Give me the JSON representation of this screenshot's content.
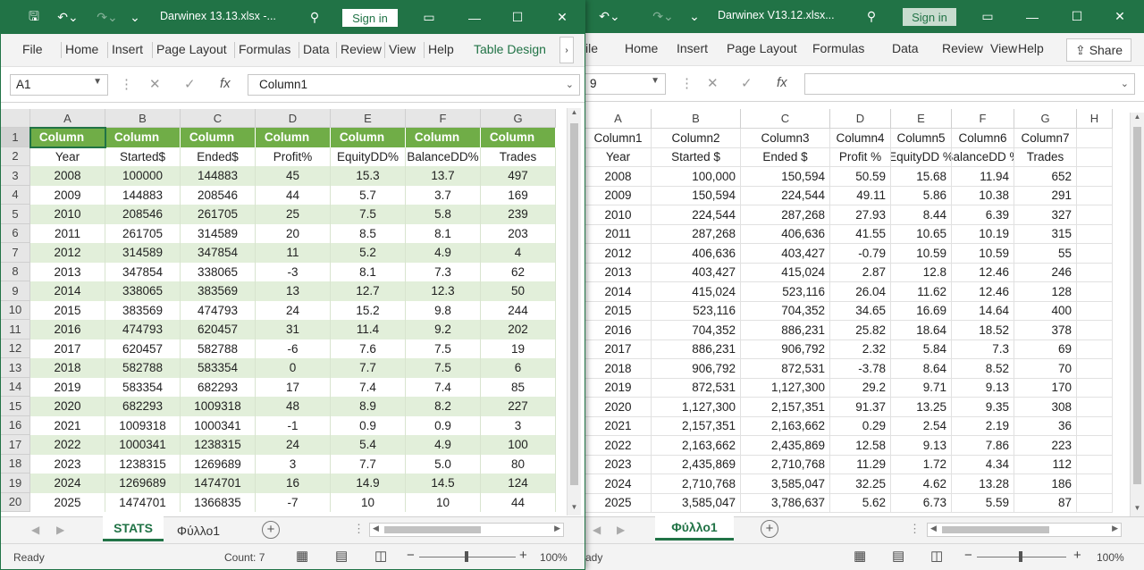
{
  "colors": {
    "accent": "#217346",
    "band": "#e2efda",
    "tableHeader": "#70ad47"
  },
  "left": {
    "title": "Darwinex 13.13.xlsx  -...",
    "sign_in": "Sign in",
    "ribbon": [
      "File",
      "Home",
      "Insert",
      "Page Layout",
      "Formulas",
      "Data",
      "Review",
      "View",
      "Help",
      "Table Design"
    ],
    "name_box": "A1",
    "formula": "Column1",
    "cols": [
      "A",
      "B",
      "C",
      "D",
      "E",
      "F",
      "G"
    ],
    "table_header": "Column",
    "rows": [
      [
        "Year",
        "Started$",
        "Ended$",
        "Profit%",
        "EquityDD%",
        "BalanceDD%",
        "Trades"
      ],
      [
        "2008",
        "100000",
        "144883",
        "45",
        "15.3",
        "13.7",
        "497"
      ],
      [
        "2009",
        "144883",
        "208546",
        "44",
        "5.7",
        "3.7",
        "169"
      ],
      [
        "2010",
        "208546",
        "261705",
        "25",
        "7.5",
        "5.8",
        "239"
      ],
      [
        "2011",
        "261705",
        "314589",
        "20",
        "8.5",
        "8.1",
        "203"
      ],
      [
        "2012",
        "314589",
        "347854",
        "11",
        "5.2",
        "4.9",
        "4"
      ],
      [
        "2013",
        "347854",
        "338065",
        "-3",
        "8.1",
        "7.3",
        "62"
      ],
      [
        "2014",
        "338065",
        "383569",
        "13",
        "12.7",
        "12.3",
        "50"
      ],
      [
        "2015",
        "383569",
        "474793",
        "24",
        "15.2",
        "9.8",
        "244"
      ],
      [
        "2016",
        "474793",
        "620457",
        "31",
        "11.4",
        "9.2",
        "202"
      ],
      [
        "2017",
        "620457",
        "582788",
        "-6",
        "7.6",
        "7.5",
        "19"
      ],
      [
        "2018",
        "582788",
        "583354",
        "0",
        "7.7",
        "7.5",
        "6"
      ],
      [
        "2019",
        "583354",
        "682293",
        "17",
        "7.4",
        "7.4",
        "85"
      ],
      [
        "2020",
        "682293",
        "1009318",
        "48",
        "8.9",
        "8.2",
        "227"
      ],
      [
        "2021",
        "1009318",
        "1000341",
        "-1",
        "0.9",
        "0.9",
        "3"
      ],
      [
        "2022",
        "1000341",
        "1238315",
        "24",
        "5.4",
        "4.9",
        "100"
      ],
      [
        "2023",
        "1238315",
        "1269689",
        "3",
        "7.7",
        "5.0",
        "80"
      ],
      [
        "2024",
        "1269689",
        "1474701",
        "16",
        "14.9",
        "14.5",
        "124"
      ],
      [
        "2025",
        "1474701",
        "1366835",
        "-7",
        "10",
        "10",
        "44"
      ]
    ],
    "sheet_tabs": [
      "STATS",
      "Φύλλο1"
    ],
    "status": "Ready",
    "count": "Count: 7",
    "zoom": "100%"
  },
  "right": {
    "title": "Darwinex V13.12.xlsx...",
    "sign_in": "Sign in",
    "share": "Share",
    "ribbon": [
      "ile",
      "Home",
      "Insert",
      "Page Layout",
      "Formulas",
      "Data",
      "Review",
      "View",
      "Help"
    ],
    "name_box": "9",
    "cols": [
      "A",
      "B",
      "C",
      "D",
      "E",
      "F",
      "G",
      "H"
    ],
    "rows": [
      [
        "Column1",
        "Column2",
        "Column3",
        "Column4",
        "Column5",
        "Column6",
        "Column7"
      ],
      [
        "Year",
        "Started $",
        "Ended $",
        "Profit %",
        "EquityDD %",
        "BalanceDD %",
        "Trades"
      ],
      [
        "2008",
        "100,000",
        "150,594",
        "50.59",
        "15.68",
        "11.94",
        "652"
      ],
      [
        "2009",
        "150,594",
        "224,544",
        "49.11",
        "5.86",
        "10.38",
        "291"
      ],
      [
        "2010",
        "224,544",
        "287,268",
        "27.93",
        "8.44",
        "6.39",
        "327"
      ],
      [
        "2011",
        "287,268",
        "406,636",
        "41.55",
        "10.65",
        "10.19",
        "315"
      ],
      [
        "2012",
        "406,636",
        "403,427",
        "-0.79",
        "10.59",
        "10.59",
        "55"
      ],
      [
        "2013",
        "403,427",
        "415,024",
        "2.87",
        "12.8",
        "12.46",
        "246"
      ],
      [
        "2014",
        "415,024",
        "523,116",
        "26.04",
        "11.62",
        "12.46",
        "128"
      ],
      [
        "2015",
        "523,116",
        "704,352",
        "34.65",
        "16.69",
        "14.64",
        "400"
      ],
      [
        "2016",
        "704,352",
        "886,231",
        "25.82",
        "18.64",
        "18.52",
        "378"
      ],
      [
        "2017",
        "886,231",
        "906,792",
        "2.32",
        "5.84",
        "7.3",
        "69"
      ],
      [
        "2018",
        "906,792",
        "872,531",
        "-3.78",
        "8.64",
        "8.52",
        "70"
      ],
      [
        "2019",
        "872,531",
        "1,127,300",
        "29.2",
        "9.71",
        "9.13",
        "170"
      ],
      [
        "2020",
        "1,127,300",
        "2,157,351",
        "91.37",
        "13.25",
        "9.35",
        "308"
      ],
      [
        "2021",
        "2,157,351",
        "2,163,662",
        "0.29",
        "2.54",
        "2.19",
        "36"
      ],
      [
        "2022",
        "2,163,662",
        "2,435,869",
        "12.58",
        "9.13",
        "7.86",
        "223"
      ],
      [
        "2023",
        "2,435,869",
        "2,710,768",
        "11.29",
        "1.72",
        "4.34",
        "112"
      ],
      [
        "2024",
        "2,710,768",
        "3,585,047",
        "32.25",
        "4.62",
        "13.28",
        "186"
      ],
      [
        "2025",
        "3,585,047",
        "3,786,637",
        "5.62",
        "6.73",
        "5.59",
        "87"
      ]
    ],
    "sheet_tab": "Φύλλο1",
    "status": "ady",
    "zoom": "100%"
  }
}
